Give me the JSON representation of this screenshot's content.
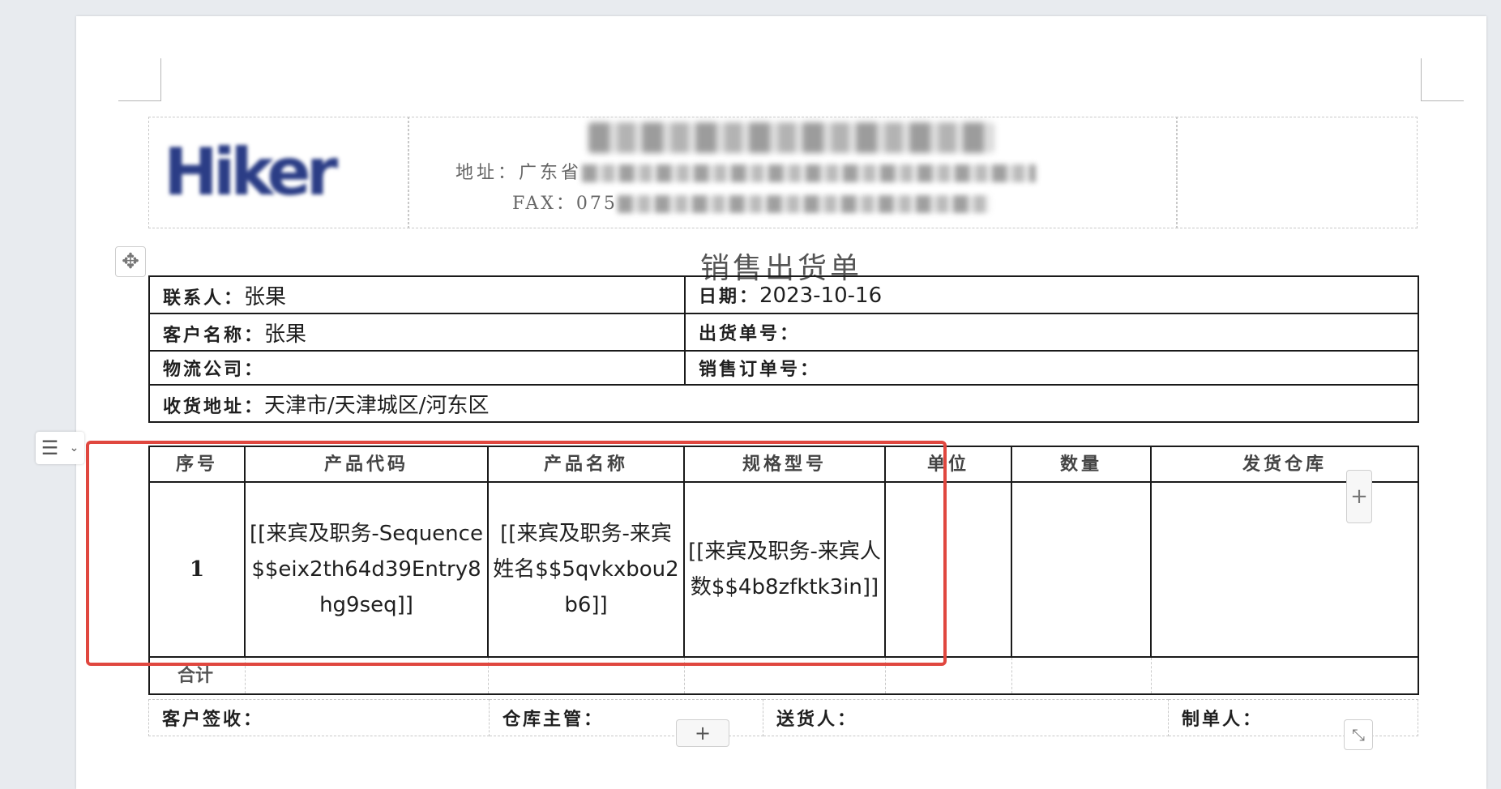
{
  "header": {
    "logo_text": "Hiker",
    "address_prefix": "地址：广东省",
    "fax_prefix": "FAX：075"
  },
  "document": {
    "title": "销售出货单"
  },
  "info": {
    "contact_label": "联系人：",
    "contact_value": "张果",
    "date_label": "日期：",
    "date_value": "2023-10-16",
    "customer_label": "客户名称：",
    "customer_value": "张果",
    "shipment_no_label": "出货单号：",
    "shipment_no_value": "",
    "logistics_label": "物流公司：",
    "logistics_value": "",
    "sales_order_label": "销售订单号：",
    "sales_order_value": "",
    "address_label": "收货地址：",
    "address_value": "天津市/天津城区/河东区"
  },
  "items": {
    "headers": [
      "序号",
      "产品代码",
      "产品名称",
      "规格型号",
      "单位",
      "数量",
      "发货仓库"
    ],
    "row": {
      "seq": "1",
      "product_code": "[[来宾及职务-Sequence$$eix2th64d39Entry8hg9seq]]",
      "product_name": "[[来宾及职务-来宾姓名$$5qvkxbou2b6]]",
      "spec": "[[来宾及职务-来宾人数$$4b8zfktk3in]]",
      "unit": "",
      "quantity": "",
      "warehouse": ""
    },
    "total_label": "合计"
  },
  "signatures": {
    "customer_sign": "客户签收：",
    "warehouse_manager": "仓库主管：",
    "deliverer": "送货人：",
    "preparer": "制单人："
  },
  "controls": {
    "move_icon": "move-icon",
    "add_symbol": "+",
    "resize_icon": "resize-icon",
    "accent_color": "#e0473f"
  }
}
